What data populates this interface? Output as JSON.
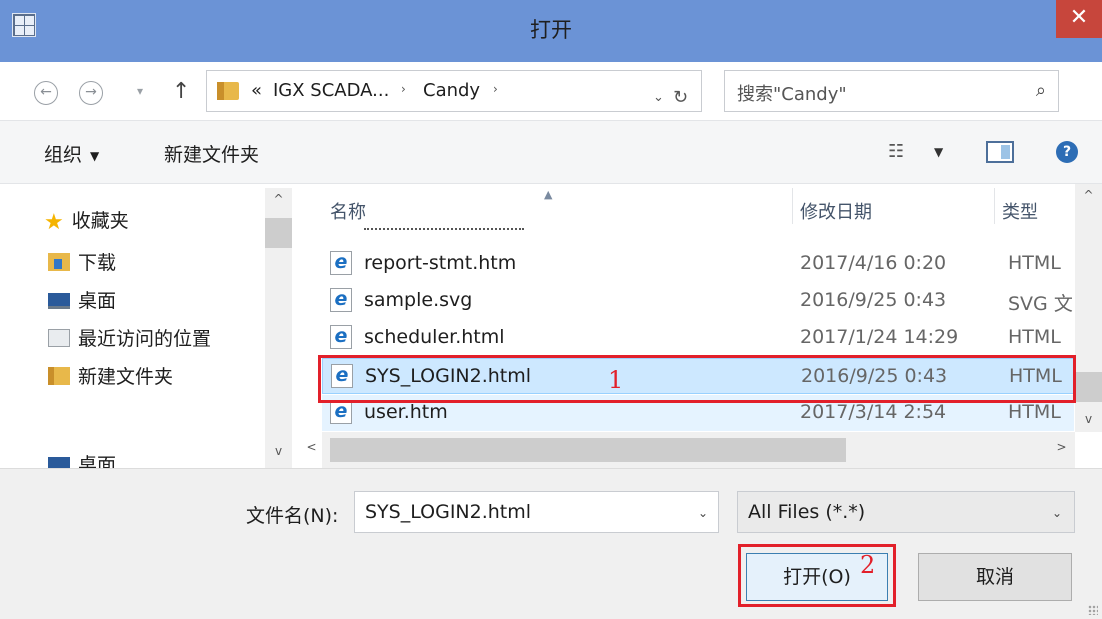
{
  "window": {
    "title": "打开",
    "close_glyph": "✕"
  },
  "nav": {
    "back_glyph": "←",
    "forward_glyph": "→",
    "recent_glyph": "▾",
    "up_glyph": "↑",
    "address_prefix": "«",
    "breadcrumb": [
      "IGX SCADA...",
      "Candy"
    ],
    "chevron_glyph": "›",
    "dropdown_glyph": "⌄",
    "refresh_glyph": "↻",
    "search_placeholder": "搜索\"Candy\"",
    "search_glyph": "⌕"
  },
  "toolbar": {
    "organize": "组织",
    "organize_caret": "▼",
    "new_folder": "新建文件夹",
    "view_glyph": "☷",
    "view_caret": "▼",
    "help_glyph": "?"
  },
  "sidebar": {
    "items": [
      {
        "label": "收藏夹",
        "icon": "star-icon",
        "glyph": "★"
      },
      {
        "label": "下载",
        "icon": "downloads-folder-icon"
      },
      {
        "label": "桌面",
        "icon": "desktop-icon"
      },
      {
        "label": "最近访问的位置",
        "icon": "recent-places-icon"
      },
      {
        "label": "新建文件夹",
        "icon": "folder-icon"
      },
      {
        "label": "桌面",
        "icon": "desktop-icon"
      }
    ],
    "scroll_up_glyph": "^",
    "scroll_down_glyph": "v"
  },
  "file_list": {
    "columns": {
      "name": "名称",
      "modified": "修改日期",
      "type": "类型"
    },
    "sort_glyph": "▲",
    "ie_glyph": "e",
    "rows": [
      {
        "name": "report-stmt.htm",
        "modified": "2017/4/16 0:20",
        "type": "HTML"
      },
      {
        "name": "sample.svg",
        "modified": "2016/9/25 0:43",
        "type": "SVG 文"
      },
      {
        "name": "scheduler.html",
        "modified": "2017/1/24 14:29",
        "type": "HTML"
      },
      {
        "name": "SYS_LOGIN2.html",
        "modified": "2016/9/25 0:43",
        "type": "HTML",
        "selected": true
      },
      {
        "name": "user.htm",
        "modified": "2017/3/14 2:54",
        "type": "HTML"
      }
    ],
    "scroll_up_glyph": "^",
    "scroll_down_glyph": "v",
    "scroll_left_glyph": "<",
    "scroll_right_glyph": ">"
  },
  "footer": {
    "filename_label": "文件名(N):",
    "filename_value": "SYS_LOGIN2.html",
    "filter_value": "All Files (*.*)",
    "dropdown_glyph": "⌄",
    "open_label": "打开(O)",
    "cancel_label": "取消"
  },
  "annotations": {
    "one": "1",
    "two": "2",
    "color": "#e2202a"
  },
  "colors": {
    "titlebar": "#6b93d6",
    "close": "#c7463c",
    "selection": "#cde8ff"
  }
}
